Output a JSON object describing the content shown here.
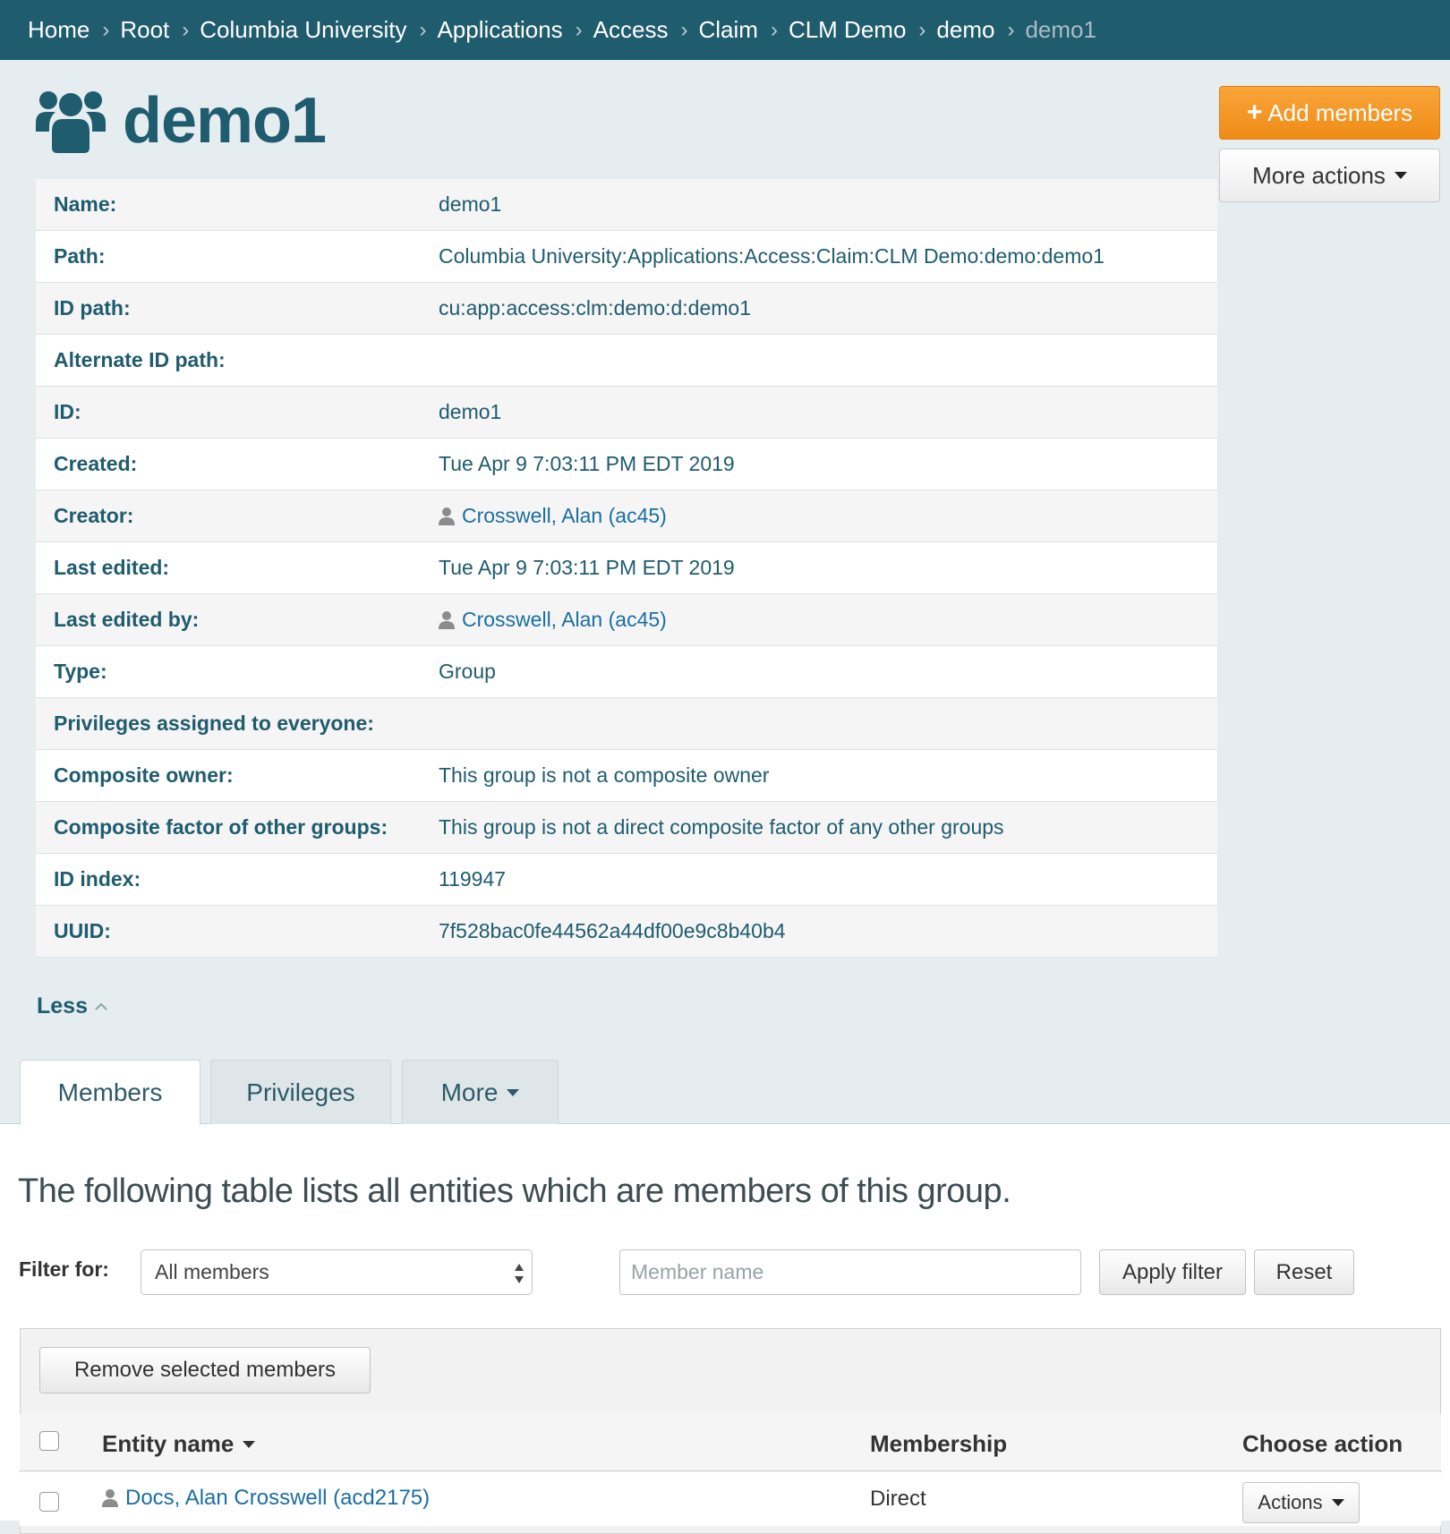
{
  "breadcrumb": [
    {
      "label": "Home"
    },
    {
      "label": "Root"
    },
    {
      "label": "Columbia University"
    },
    {
      "label": "Applications"
    },
    {
      "label": "Access"
    },
    {
      "label": "Claim"
    },
    {
      "label": "CLM Demo"
    },
    {
      "label": "demo"
    },
    {
      "label": "demo1"
    }
  ],
  "header": {
    "title": "demo1",
    "icon": "group-icon",
    "add_members_label": "Add members",
    "more_actions_label": "More actions"
  },
  "details": [
    {
      "label": "Name:",
      "value": "demo1"
    },
    {
      "label": "Path:",
      "value": "Columbia University:Applications:Access:Claim:CLM Demo:demo:demo1"
    },
    {
      "label": "ID path:",
      "value": "cu:app:access:clm:demo:d:demo1"
    },
    {
      "label": "Alternate ID path:",
      "value": ""
    },
    {
      "label": "ID:",
      "value": "demo1"
    },
    {
      "label": "Created:",
      "value": "Tue Apr 9 7:03:11 PM EDT 2019"
    },
    {
      "label": "Creator:",
      "value": "Crosswell, Alan (ac45)"
    },
    {
      "label": "Last edited:",
      "value": "Tue Apr 9 7:03:11 PM EDT 2019"
    },
    {
      "label": "Last edited by:",
      "value": "Crosswell, Alan (ac45)"
    },
    {
      "label": "Type:",
      "value": "Group"
    },
    {
      "label": "Privileges assigned to everyone:",
      "value": ""
    },
    {
      "label": "Composite owner:",
      "value": "This group is not a composite owner"
    },
    {
      "label": "Composite factor of other groups:",
      "value": "This group is not a direct composite factor of any other groups"
    },
    {
      "label": "ID index:",
      "value": "119947"
    },
    {
      "label": "UUID:",
      "value": "7f528bac0fe44562a44df00e9c8b40b4"
    }
  ],
  "less_label": "Less",
  "tabs": [
    {
      "label": "Members"
    },
    {
      "label": "Privileges"
    },
    {
      "label": "More"
    }
  ],
  "members": {
    "intro": "The following table lists all entities which are members of this group.",
    "filter_label": "Filter for:",
    "filter_value": "All members",
    "name_placeholder": "Member name",
    "apply_label": "Apply filter",
    "reset_label": "Reset",
    "remove_label": "Remove selected members",
    "columns": {
      "entity": "Entity name",
      "membership": "Membership",
      "action": "Choose action"
    },
    "rows": [
      {
        "name": "Docs, Alan Crosswell (acd2175)",
        "membership": "Direct",
        "action_label": "Actions"
      }
    ]
  },
  "colors": {
    "header_bg": "#1f5c6e",
    "accent": "#ef8c16",
    "link": "#1a6fa0"
  }
}
